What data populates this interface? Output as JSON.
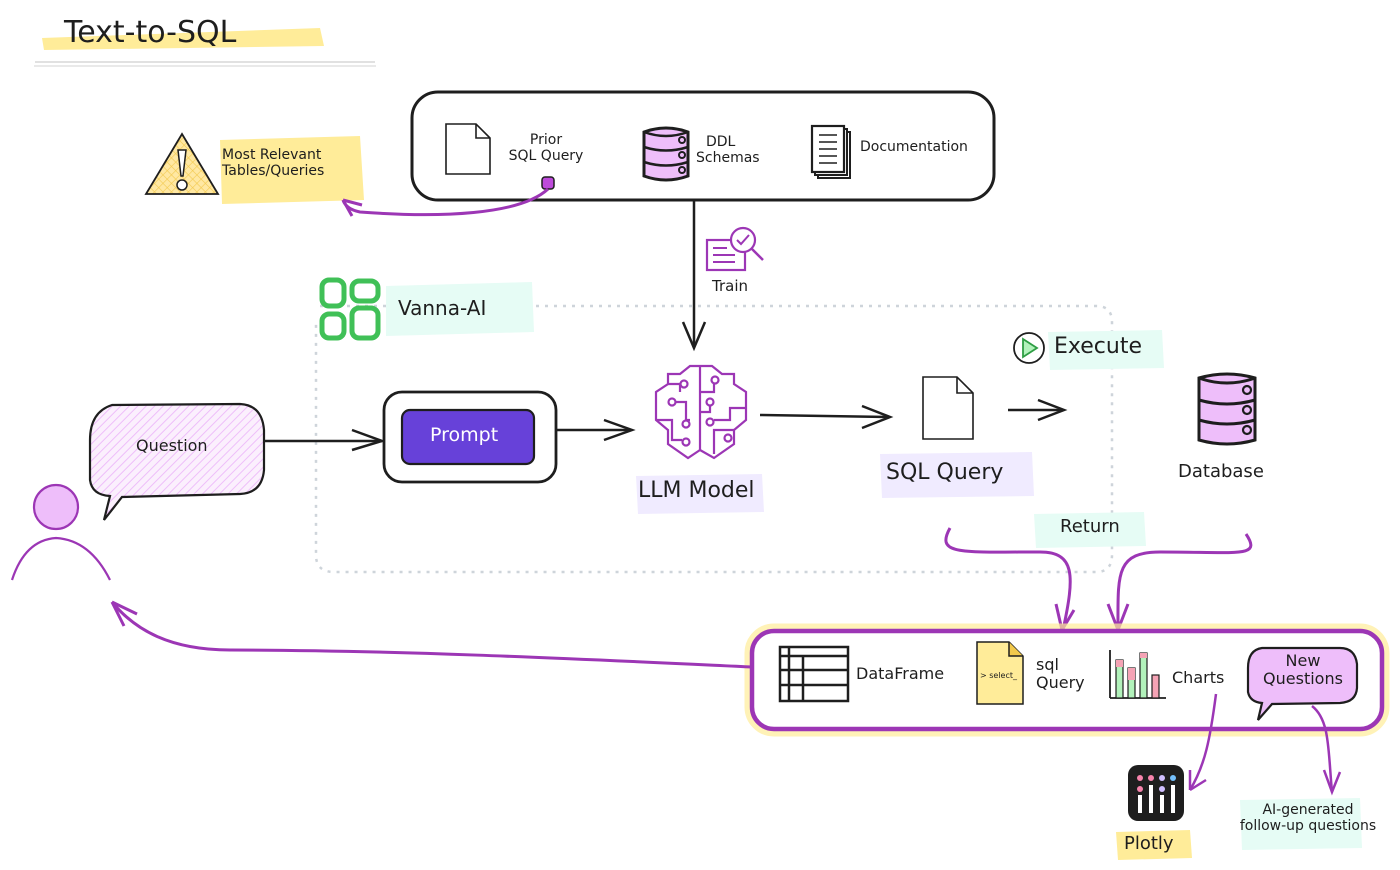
{
  "title": "Text-to-SQL",
  "colors": {
    "purple": "#9c36b5",
    "lilac_fill": "#eebefa",
    "prompt_fill": "#6741d9",
    "yellow_highlight": "#ffec99",
    "mint_highlight": "#e6fcf5",
    "lavender_highlight": "#f0ebff",
    "green": "#40c057",
    "dashed_border": "#ced4da"
  },
  "training_sources": {
    "items": [
      {
        "label_line1": "Prior",
        "label_line2": "SQL Query",
        "icon": "document-icon"
      },
      {
        "label_line1": "DDL",
        "label_line2": "Schemas",
        "icon": "database-icon"
      },
      {
        "label_line1": "Documentation",
        "label_line2": "",
        "icon": "documents-stack-icon"
      }
    ]
  },
  "retrieval_note": {
    "line1": "Most Relevant",
    "line2": "Tables/Queries",
    "icon": "warning-icon"
  },
  "train": {
    "label": "Train",
    "icon": "training-doc-search-icon"
  },
  "vanna": {
    "label": "Vanna-AI",
    "icon": "app-grid-icon"
  },
  "question": {
    "label": "Question"
  },
  "prompt": {
    "label": "Prompt"
  },
  "llm": {
    "label": "LLM Model",
    "icon": "brain-circuit-icon"
  },
  "sql_query": {
    "label": "SQL Query"
  },
  "execute": {
    "label": "Execute",
    "icon": "play-icon"
  },
  "database": {
    "label": "Database"
  },
  "return": {
    "label": "Return"
  },
  "outputs": {
    "dataframe": {
      "label": "DataFrame"
    },
    "sql": {
      "line1": "sql",
      "line2": "Query",
      "snippet": "> select_"
    },
    "charts": {
      "label": "Charts"
    },
    "new_questions": {
      "line1": "New",
      "line2": "Questions"
    }
  },
  "plotly": {
    "label": "Plotly"
  },
  "followup": {
    "line1": "AI-generated",
    "line2": "follow-up questions"
  }
}
